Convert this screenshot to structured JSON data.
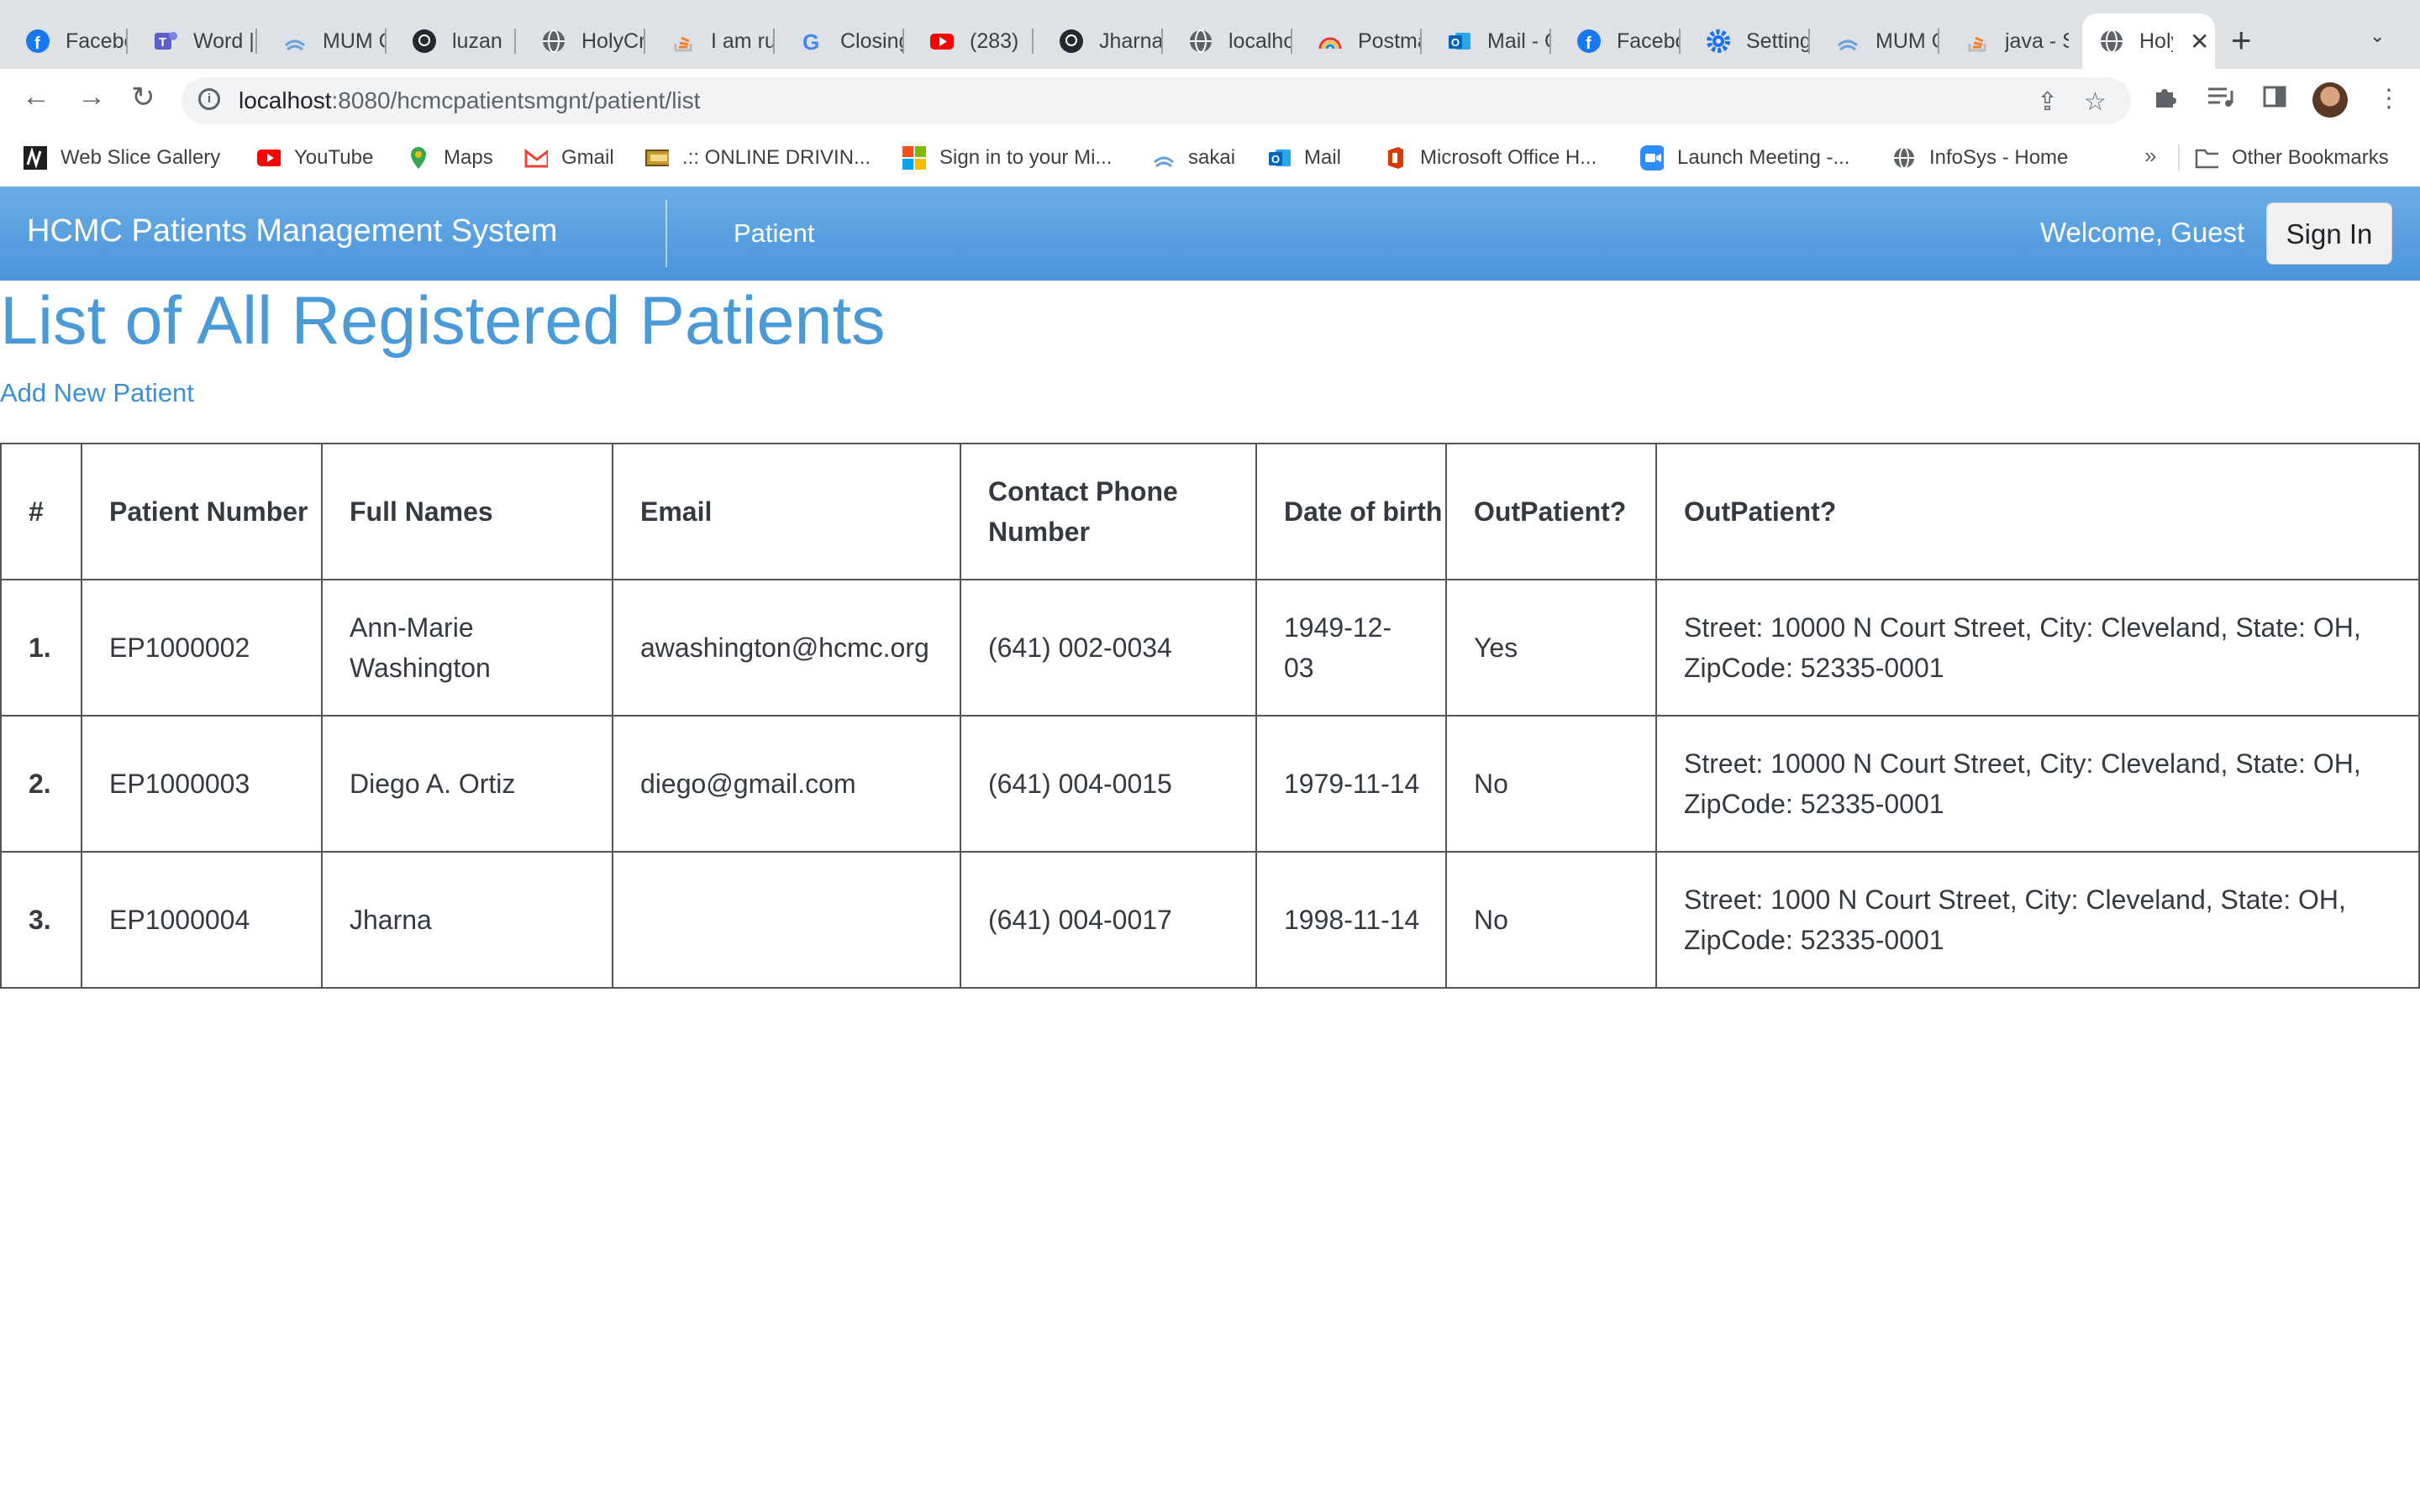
{
  "browser": {
    "tabs": [
      {
        "title": "Facebook",
        "icon": "facebook-icon"
      },
      {
        "title": "Word | Microsoft Teams",
        "icon": "teams-icon"
      },
      {
        "title": "MUM Canvas",
        "icon": "canvas-icon"
      },
      {
        "title": "luzan",
        "icon": "github-icon"
      },
      {
        "title": "HolyCross",
        "icon": "globe-icon"
      },
      {
        "title": "I am running",
        "icon": "stackoverflow-icon"
      },
      {
        "title": "Closing",
        "icon": "google-icon"
      },
      {
        "title": "(283)",
        "icon": "youtube-icon"
      },
      {
        "title": "Jharna",
        "icon": "github-icon"
      },
      {
        "title": "localhost",
        "icon": "globe-icon"
      },
      {
        "title": "Postman",
        "icon": "rainbow-icon"
      },
      {
        "title": "Mail - Outlook",
        "icon": "outlook-icon"
      },
      {
        "title": "Facebook",
        "icon": "facebook-icon"
      },
      {
        "title": "Settings",
        "icon": "settings-gear-icon"
      },
      {
        "title": "MUM Canvas",
        "icon": "canvas-icon"
      },
      {
        "title": "java - Stack",
        "icon": "stackoverflow-icon"
      }
    ],
    "active_tab": {
      "title": "HolyCross",
      "icon": "globe-icon"
    },
    "url_host": "localhost",
    "url_path": ":8080/hcmcpatientsmgnt/patient/list",
    "bookmarks": [
      {
        "label": "Web Slice Gallery",
        "icon": "web-slice-icon"
      },
      {
        "label": "YouTube",
        "icon": "youtube-icon"
      },
      {
        "label": "Maps",
        "icon": "maps-pin-icon"
      },
      {
        "label": "Gmail",
        "icon": "gmail-icon"
      },
      {
        "label": ".:: ONLINE DRIVIN...",
        "icon": "driving-icon"
      },
      {
        "label": "Sign in to your Mi...",
        "icon": "microsoft-icon"
      },
      {
        "label": "sakai",
        "icon": "sakai-icon"
      },
      {
        "label": "Mail",
        "icon": "outlook-icon"
      },
      {
        "label": "Microsoft Office H...",
        "icon": "office-icon"
      },
      {
        "label": "Launch Meeting -...",
        "icon": "zoom-icon"
      },
      {
        "label": "InfoSys - Home",
        "icon": "globe-icon"
      }
    ],
    "other_bookmarks": "Other Bookmarks",
    "more_bookmarks": "»"
  },
  "navbar": {
    "brand": "HCMC Patients Management System",
    "link": "Patient",
    "welcome": "Welcome, Guest",
    "sign_in": "Sign In",
    "color": "#4a94dc"
  },
  "page": {
    "title": "List of All Registered Patients",
    "add_link": "Add New Patient",
    "title_color": "#4a9ad8"
  },
  "table": {
    "headers": [
      "#",
      "Patient Number",
      "Full Names",
      "Email",
      "Contact Phone Number",
      "Date of birth",
      "OutPatient?",
      "OutPatient?"
    ],
    "rows": [
      {
        "num": "1.",
        "patient_number": "EP1000002",
        "full_name": "Ann-Marie Washington",
        "email": "awashington@hcmc.org",
        "phone": "(641) 002-0034",
        "dob": "1949-12-03",
        "outpatient": "Yes",
        "address": "Street: 10000 N Court Street, City: Cleveland, State: OH, ZipCode: 52335-0001"
      },
      {
        "num": "2.",
        "patient_number": "EP1000003",
        "full_name": "Diego A. Ortiz",
        "email": "diego@gmail.com",
        "phone": "(641) 004-0015",
        "dob": "1979-11-14",
        "outpatient": "No",
        "address": "Street: 10000 N Court Street, City: Cleveland, State: OH, ZipCode: 52335-0001"
      },
      {
        "num": "3.",
        "patient_number": "EP1000004",
        "full_name": "Jharna",
        "email": "",
        "phone": "(641) 004-0017",
        "dob": "1998-11-14",
        "outpatient": "No",
        "address": "Street: 1000 N Court Street, City: Cleveland, State: OH, ZipCode: 52335-0001"
      }
    ]
  }
}
